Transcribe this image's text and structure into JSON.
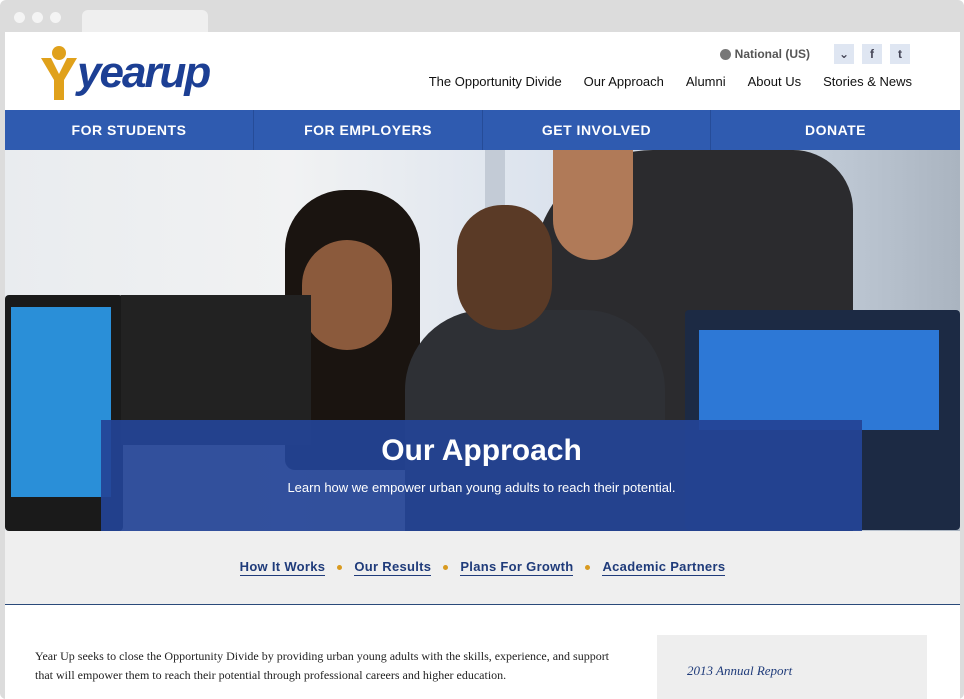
{
  "brand": {
    "name": "yearup"
  },
  "topbar": {
    "region": "National (US)",
    "icons": [
      "chevron-down-icon",
      "facebook-icon",
      "twitter-icon"
    ]
  },
  "mainnav": [
    "The Opportunity Divide",
    "Our Approach",
    "Alumni",
    "About Us",
    "Stories & News"
  ],
  "bluenav": [
    "FOR STUDENTS",
    "FOR EMPLOYERS",
    "GET INVOLVED",
    "DONATE"
  ],
  "hero": {
    "title": "Our Approach",
    "subtitle": "Learn how we empower urban young adults to reach their potential."
  },
  "subnav": [
    "How It Works",
    "Our Results",
    "Plans For Growth",
    "Academic Partners"
  ],
  "body": {
    "intro": "Year Up seeks to close the Opportunity Divide by providing urban young adults with the skills, experience, and support that will empower them to reach their potential through professional careers and higher education."
  },
  "sidebar": {
    "annual_report": "2013 Annual Report"
  },
  "colors": {
    "brand_blue": "#2f5bb0",
    "logo_blue": "#1c3f94",
    "logo_gold": "#e0a11b",
    "accent_bullet": "#d99a1f"
  }
}
